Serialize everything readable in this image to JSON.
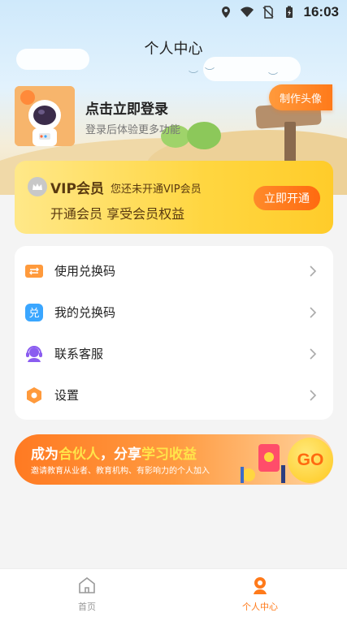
{
  "status_bar": {
    "time": "16:03"
  },
  "header": {
    "title": "个人中心"
  },
  "profile": {
    "login_title": "点击立即登录",
    "login_subtitle": "登录后体验更多功能",
    "make_avatar_label": "制作头像"
  },
  "vip": {
    "title": "VIP会员",
    "status": "您还未开通VIP会员",
    "slogan": "开通会员 享受会员权益",
    "open_label": "立即开通"
  },
  "menu": {
    "items": [
      {
        "label": "使用兑换码",
        "icon": "ticket-icon",
        "color": "#ff9a3c"
      },
      {
        "label": "我的兑换码",
        "icon": "exchange-icon",
        "color": "#3aa6ff"
      },
      {
        "label": "联系客服",
        "icon": "headset-icon",
        "color": "#8a5cf0"
      },
      {
        "label": "设置",
        "icon": "settings-icon",
        "color": "#ff9a3c"
      }
    ]
  },
  "banner": {
    "title_part1": "成为",
    "title_hl1": "合伙人",
    "title_part2": "，分享",
    "title_hl2": "学习收益",
    "subtitle": "邀请教育从业者、教育机构、有影响力的个人加入",
    "go_label": "GO"
  },
  "bottom_nav": {
    "items": [
      {
        "label": "首页",
        "active": false
      },
      {
        "label": "个人中心",
        "active": true
      }
    ]
  },
  "colors": {
    "accent": "#ff7a1a",
    "vip_gold": "#ffd640",
    "nav_active": "#ff7a1a",
    "nav_inactive": "#999999"
  }
}
